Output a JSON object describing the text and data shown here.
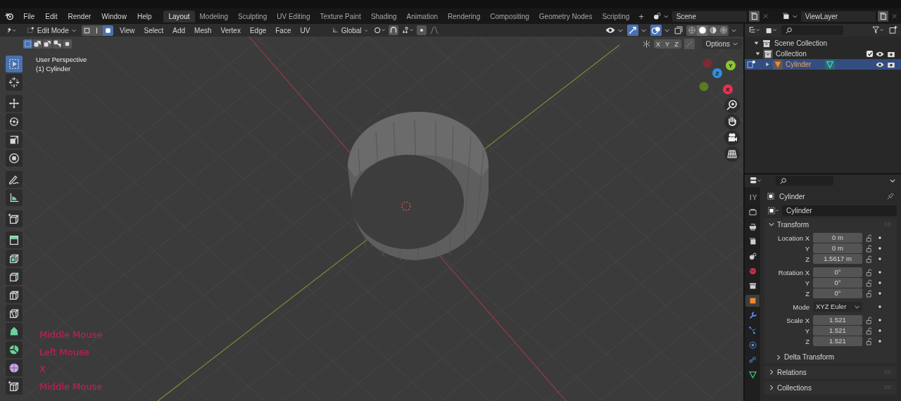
{
  "menu": [
    "File",
    "Edit",
    "Render",
    "Window",
    "Help"
  ],
  "workspaces": [
    {
      "label": "Layout",
      "selected": true
    },
    {
      "label": "Modeling",
      "selected": false
    },
    {
      "label": "Sculpting",
      "selected": false
    },
    {
      "label": "UV Editing",
      "selected": false
    },
    {
      "label": "Texture Paint",
      "selected": false
    },
    {
      "label": "Shading",
      "selected": false
    },
    {
      "label": "Animation",
      "selected": false
    },
    {
      "label": "Rendering",
      "selected": false
    },
    {
      "label": "Compositing",
      "selected": false
    },
    {
      "label": "Geometry Nodes",
      "selected": false
    },
    {
      "label": "Scripting",
      "selected": false
    }
  ],
  "add_workspace": "+",
  "scene": {
    "name": "Scene"
  },
  "view_layer": {
    "name": "ViewLayer"
  },
  "header": {
    "mode": "Edit Mode",
    "select_modes": [
      {
        "kind": "vertex",
        "selected": false
      },
      {
        "kind": "edge",
        "selected": false
      },
      {
        "kind": "face",
        "selected": true
      }
    ],
    "menus": [
      "View",
      "Select",
      "Add",
      "Mesh",
      "Vertex",
      "Edge",
      "Face",
      "UV"
    ],
    "orientation": "Global",
    "shading_modes": [
      {
        "kind": "wireframe",
        "selected": false
      },
      {
        "kind": "solid",
        "selected": true
      },
      {
        "kind": "material",
        "selected": false
      },
      {
        "kind": "rendered",
        "selected": false
      }
    ],
    "box_modes": [
      {
        "kind": "new",
        "selected": true
      },
      {
        "kind": "extend",
        "selected": false
      },
      {
        "kind": "subtract",
        "selected": false
      },
      {
        "kind": "invert",
        "selected": false
      },
      {
        "kind": "intersect",
        "selected": false
      }
    ],
    "mirror_axes": [
      "X",
      "Y",
      "Z"
    ],
    "options": "Options"
  },
  "viewport": {
    "info": [
      "User Perspective",
      "(1) Cylinder"
    ],
    "key_log": [
      "Middle Mouse",
      "Left Mouse",
      "X",
      "Middle Mouse"
    ],
    "gizmo": [
      {
        "label": "Y",
        "color": "#8ac733"
      },
      {
        "label": "Z",
        "color": "#2f8ee0"
      },
      {
        "label": "X",
        "color": "#e8304f"
      }
    ]
  },
  "tool_groups": [
    {
      "tools": [
        {
          "kind": "select",
          "selected": true
        },
        {
          "kind": "cursor",
          "selected": false
        }
      ]
    },
    {
      "tools": [
        {
          "kind": "move",
          "selected": false
        },
        {
          "kind": "rotate",
          "selected": false
        },
        {
          "kind": "scale",
          "selected": false
        },
        {
          "kind": "transform",
          "selected": false
        }
      ]
    },
    {
      "tools": [
        {
          "kind": "annotate",
          "selected": false
        },
        {
          "kind": "measure",
          "selected": false
        }
      ]
    },
    {
      "tools": [
        {
          "kind": "add-cube",
          "selected": false
        }
      ]
    },
    {
      "tools": [
        {
          "kind": "extrude",
          "selected": false
        },
        {
          "kind": "inset",
          "selected": false
        },
        {
          "kind": "bevel",
          "selected": false
        },
        {
          "kind": "loop-cut",
          "selected": false
        },
        {
          "kind": "knife",
          "selected": false
        },
        {
          "kind": "poly-build",
          "selected": false
        },
        {
          "kind": "spin",
          "selected": false
        },
        {
          "kind": "smooth",
          "selected": false
        },
        {
          "kind": "shrink",
          "selected": false
        }
      ]
    }
  ],
  "outliner": {
    "tree": [
      {
        "label": "Scene Collection",
        "kind": "scene-collection",
        "selected": false,
        "expanded": true,
        "children": [
          {
            "label": "Collection",
            "kind": "collection",
            "selected": false,
            "expanded": true,
            "checked": true,
            "children": [
              {
                "label": "Cylinder",
                "kind": "mesh-object",
                "selected": true,
                "expanded": false
              }
            ]
          }
        ]
      }
    ]
  },
  "properties": {
    "tabs": [
      {
        "kind": "tool",
        "selected": false
      },
      {
        "kind": "render",
        "selected": false
      },
      {
        "kind": "output",
        "selected": false
      },
      {
        "kind": "view-layer",
        "selected": false
      },
      {
        "kind": "scene",
        "selected": false
      },
      {
        "kind": "world",
        "selected": false
      },
      {
        "kind": "collection",
        "selected": false
      },
      {
        "kind": "object",
        "selected": true
      },
      {
        "kind": "modifiers",
        "selected": false
      },
      {
        "kind": "particles",
        "selected": false
      },
      {
        "kind": "physics",
        "selected": false
      },
      {
        "kind": "constraints",
        "selected": false
      },
      {
        "kind": "data",
        "selected": false
      }
    ],
    "object_name": "Cylinder",
    "data_name": "Cylinder",
    "panels": [
      {
        "title": "Transform",
        "expanded": true,
        "groups": [
          {
            "rows": [
              {
                "label": "Location X",
                "value": "0 m",
                "kind": "number"
              },
              {
                "label": "Y",
                "value": "0 m",
                "kind": "number"
              },
              {
                "label": "Z",
                "value": "1.5617 m",
                "kind": "number"
              }
            ]
          },
          {
            "rows": [
              {
                "label": "Rotation X",
                "value": "0°",
                "kind": "number"
              },
              {
                "label": "Y",
                "value": "0°",
                "kind": "number"
              },
              {
                "label": "Z",
                "value": "0°",
                "kind": "number"
              }
            ]
          },
          {
            "rows": [
              {
                "label": "Mode",
                "value": "XYZ Euler",
                "kind": "dropdown"
              }
            ]
          },
          {
            "rows": [
              {
                "label": "Scale X",
                "value": "1.521",
                "kind": "number"
              },
              {
                "label": "Y",
                "value": "1.521",
                "kind": "number"
              },
              {
                "label": "Z",
                "value": "1.521",
                "kind": "number"
              }
            ]
          }
        ],
        "subpanels": [
          {
            "title": "Delta Transform",
            "expanded": false
          }
        ]
      },
      {
        "title": "Relations",
        "expanded": false
      },
      {
        "title": "Collections",
        "expanded": false
      }
    ]
  }
}
